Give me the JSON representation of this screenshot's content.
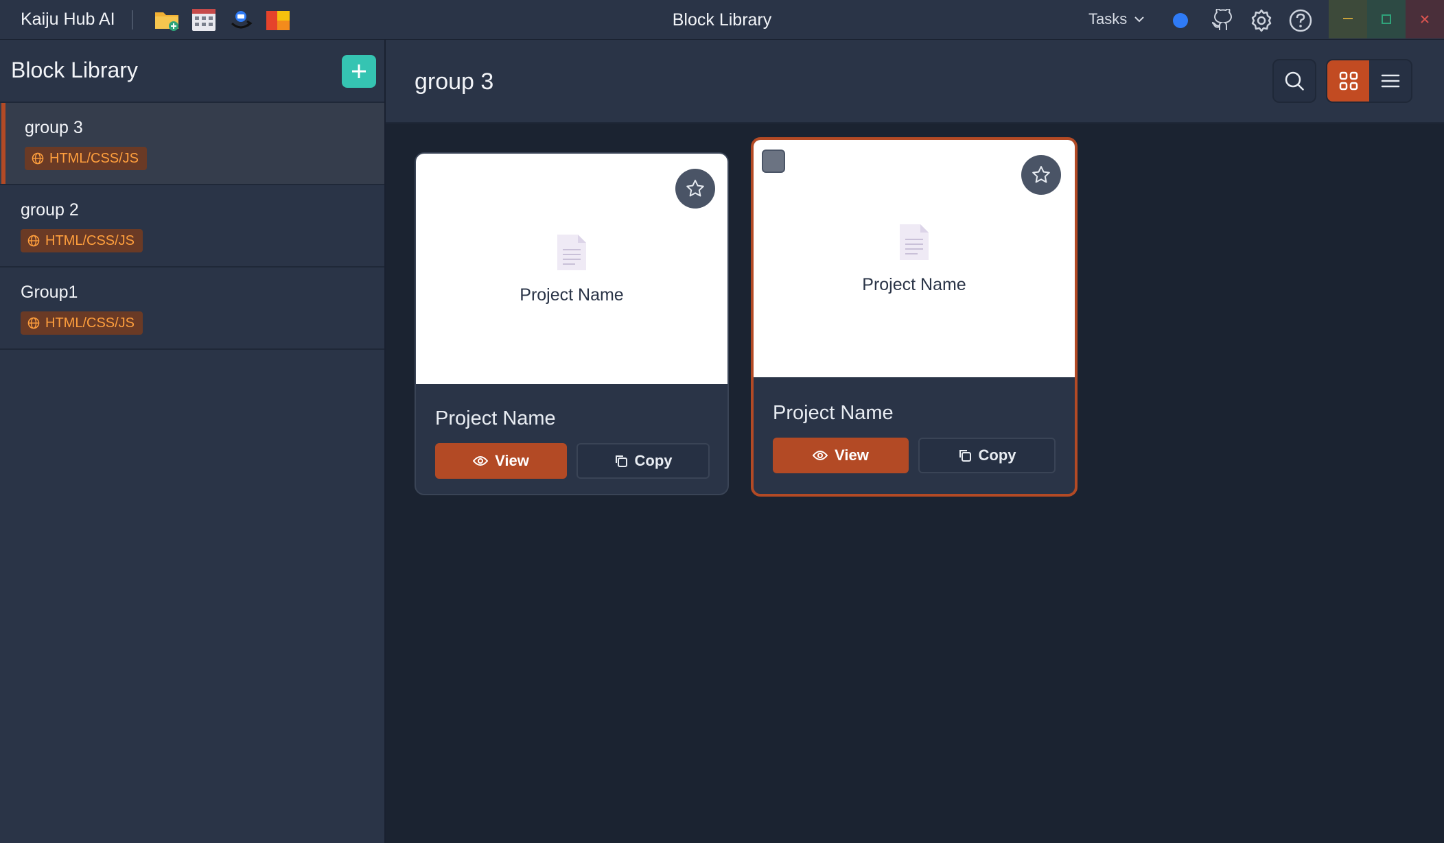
{
  "app": {
    "name": "Kaiju Hub AI",
    "window_title": "Block Library",
    "tasks_label": "Tasks"
  },
  "sidebar": {
    "title": "Block Library",
    "groups": [
      {
        "name": "group 3",
        "tag": "HTML/CSS/JS",
        "active": true
      },
      {
        "name": "group 2",
        "tag": "HTML/CSS/JS",
        "active": false
      },
      {
        "name": "Group1",
        "tag": "HTML/CSS/JS",
        "active": false
      }
    ]
  },
  "main": {
    "title": "group 3",
    "cards": [
      {
        "preview_name": "Project Name",
        "name": "Project Name",
        "view_label": "View",
        "copy_label": "Copy",
        "selected": false
      },
      {
        "preview_name": "Project Name",
        "name": "Project Name",
        "view_label": "View",
        "copy_label": "Copy",
        "selected": true
      }
    ]
  },
  "colors": {
    "accent": "#b34a25",
    "add_button": "#35c4b2",
    "tag_text": "#ff9f3d",
    "status_dot": "#2f7bf6"
  }
}
